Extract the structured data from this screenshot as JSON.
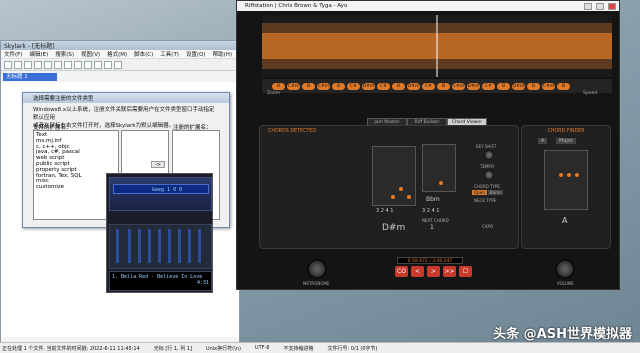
{
  "skylark": {
    "title": "Skylark - [无标题]",
    "menu": [
      "文件(F)",
      "编辑(E)",
      "搜索(S)",
      "视图(V)",
      "格式(M)",
      "脚本(C)",
      "工具(T)",
      "设置(O)",
      "帮助(H)"
    ],
    "doc_tab": "无标题 1"
  },
  "dialog": {
    "title": "选择需要注册的文件类型",
    "body_line1": "Windows8.x以上系统，注册文件关联后需要用户在文件类型窗口手动指定默认应用",
    "body_line2": "或者在鼠标右击文件打开时，选择Skylark为默认编辑器。",
    "left_label": "支持的扩展名：",
    "right_label": "注册的扩展名：",
    "extensions": [
      "Text",
      "ms.mj.inf",
      "c, c++, objc",
      "java, c#, pascal",
      "web script",
      "public script",
      "property script",
      "fortran, Tex, SQL",
      "misc",
      "customize"
    ],
    "arrow": "->"
  },
  "winamp": {
    "display": "Geeg 1 0 0",
    "playlist_item": "1. Bella Red - Believe In Love",
    "time": "4:31"
  },
  "riffstation": {
    "title": "Riffstation | Chris Brown & Tyga - Ayo",
    "timeline_chords": [
      "B",
      "C#m",
      "B",
      "C#m",
      "B",
      "C#",
      "D#m",
      "C#",
      "B",
      "D#m",
      "C#",
      "B",
      "C#m",
      "D#m",
      "C#",
      "B",
      "D#m",
      "B",
      "C#m",
      "B",
      "C#m",
      "D#m",
      "B",
      "B",
      "C#m",
      "C#m",
      "D#m",
      "D#m"
    ],
    "zoom_label": "Zoom",
    "speed_label": "Speed",
    "tabs": [
      "Jam Master",
      "Riff Builder",
      "Chord Viewer"
    ],
    "chords_detected": "CHORDS DETECTED",
    "chord_finder": "CHORD FINDER",
    "main_chord": "D#m",
    "main_fingering": "3 2 4 1",
    "mid_chord": "Bbm",
    "mid_fingering": "3 2 4 1",
    "next_chord_label": "NEXT CHORD",
    "next_chord_value": "1",
    "key_shift": "KEY SHIFT",
    "tempo": "TEMPO",
    "chord_type": "CHORD TYPE",
    "chord_type_options": [
      "Open",
      "Barre"
    ],
    "neck_type": "NECK TYPE",
    "capo": "CAPO",
    "finder_root": "A",
    "finder_quality": "Major",
    "finder_chord": "A",
    "counter": "0:59.672 / 3:46.247",
    "metronome": "METRONOME",
    "volume": "VOLUME",
    "transport": [
      "CO",
      "<",
      ">",
      ">>",
      "☐"
    ]
  },
  "status": {
    "items": [
      "正在处理 1 个文件, 当前文件的时间戳: 2022-6-11 11:45:14",
      "光标 [行 1, 列 1]",
      "Unix换行符(\\n)",
      "UTF-8",
      "不支持缩进格",
      "文件行号: 0/1 (0字节)"
    ]
  },
  "watermark": "头条 @ASH世界模拟器"
}
